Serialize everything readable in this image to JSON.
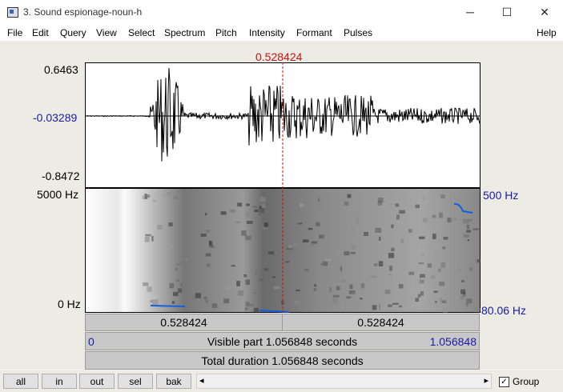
{
  "window": {
    "title": "3. Sound espionage-noun-h",
    "controls": [
      "─",
      "☐",
      "✕"
    ]
  },
  "menu": {
    "items": [
      "File",
      "Edit",
      "Query",
      "View",
      "Select",
      "Spectrum",
      "Pitch",
      "Intensity",
      "Formant",
      "Pulses"
    ],
    "help": "Help"
  },
  "waveform": {
    "max_label": "0.6463",
    "zero_label": "-0.03289",
    "min_label": "-0.8472"
  },
  "cursor": {
    "time_label": "0.528424"
  },
  "spectrogram": {
    "max_freq_label": "5000 Hz",
    "min_freq_label": "0 Hz",
    "pitch_max_label": "500 Hz",
    "pitch_min_label": "80.06 Hz"
  },
  "time_bars": {
    "left_segment": "0.528424",
    "right_segment": "0.528424",
    "visible_start": "0",
    "visible_text": "Visible part 1.056848 seconds",
    "visible_end": "1.056848",
    "total_text": "Total duration 1.056848 seconds"
  },
  "nav_buttons": [
    "all",
    "in",
    "out",
    "sel",
    "bak"
  ],
  "scrollbar": {
    "left_arrow": "◂",
    "right_arrow": "▸"
  },
  "group": {
    "label": "Group",
    "checked": true,
    "check_mark": "✓"
  },
  "colors": {
    "cursor": "#cc1111",
    "axis_labels": "#1a1aa8",
    "pitch_curve": "#1060e0"
  }
}
